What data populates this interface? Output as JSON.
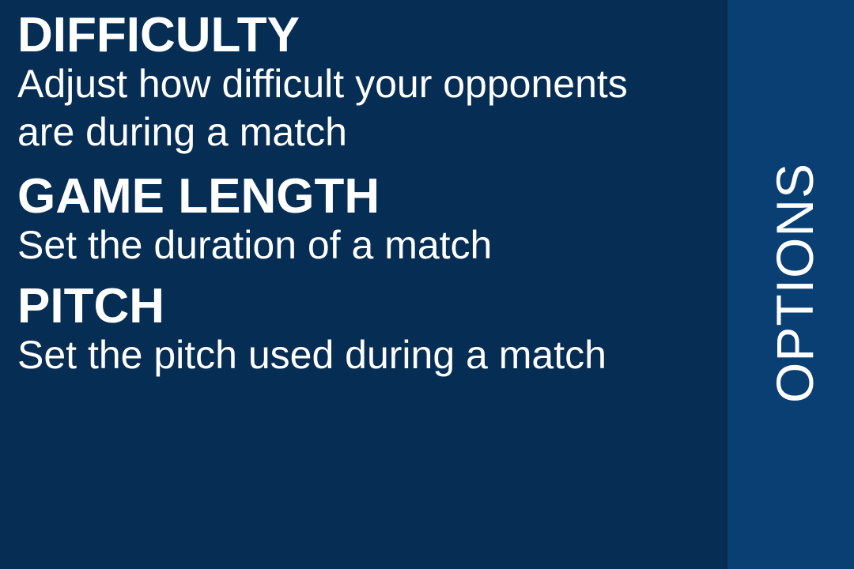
{
  "options": [
    {
      "title": "DIFFICULTY",
      "description": "Adjust how difficult your opponents are during a match",
      "lines": [
        "Adjust how difficult your opponents",
        "are during a match"
      ]
    },
    {
      "title": "GAME LENGTH",
      "description": "Set the duration of a match",
      "lines": [
        "Set the duration of a match"
      ]
    },
    {
      "title": "PITCH",
      "description": "Set the pitch used during a match",
      "lines": [
        "Set the pitch used during a match"
      ]
    }
  ],
  "sidebar": {
    "label": "OPTIONS"
  },
  "colors": {
    "background": "#062d53",
    "sidebar": "#0a3f74",
    "text": "#ffffff"
  }
}
